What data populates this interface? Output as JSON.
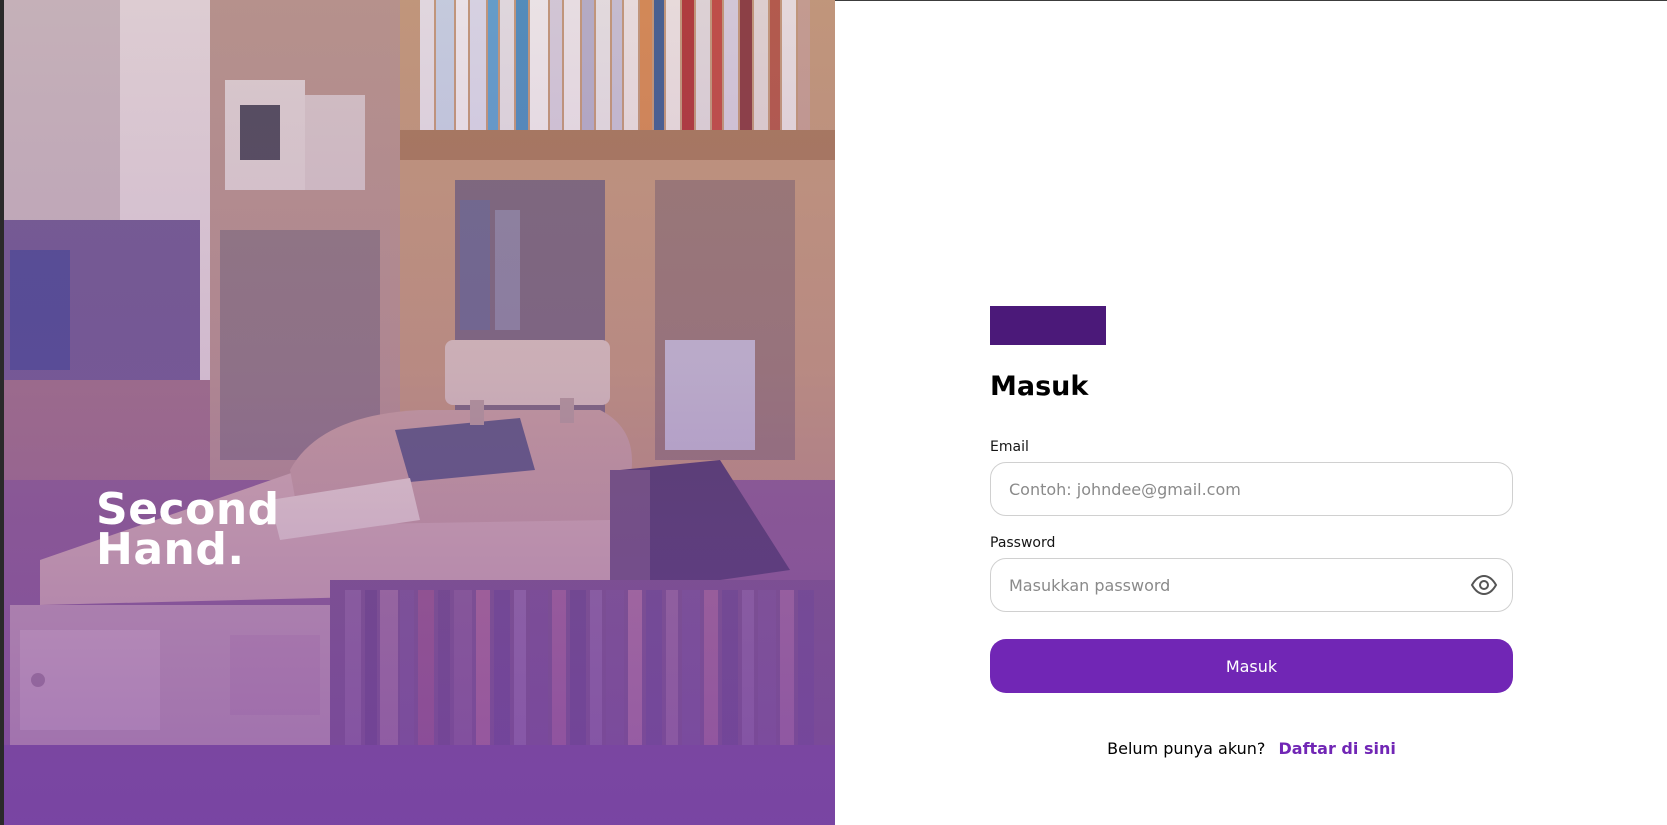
{
  "hero": {
    "brand_line1": "Second",
    "brand_line2": "Hand."
  },
  "form": {
    "title": "Masuk",
    "email_label": "Email",
    "email_placeholder": "Contoh: johndee@gmail.com",
    "password_label": "Password",
    "password_placeholder": "Masukkan password",
    "submit_label": "Masuk"
  },
  "signup": {
    "prompt": "Belum punya akun?",
    "link_label": "Daftar di sini"
  },
  "icons": {
    "password_toggle": "eye-icon"
  },
  "colors": {
    "primary": "#7126b5",
    "logo": "#4b1979"
  }
}
